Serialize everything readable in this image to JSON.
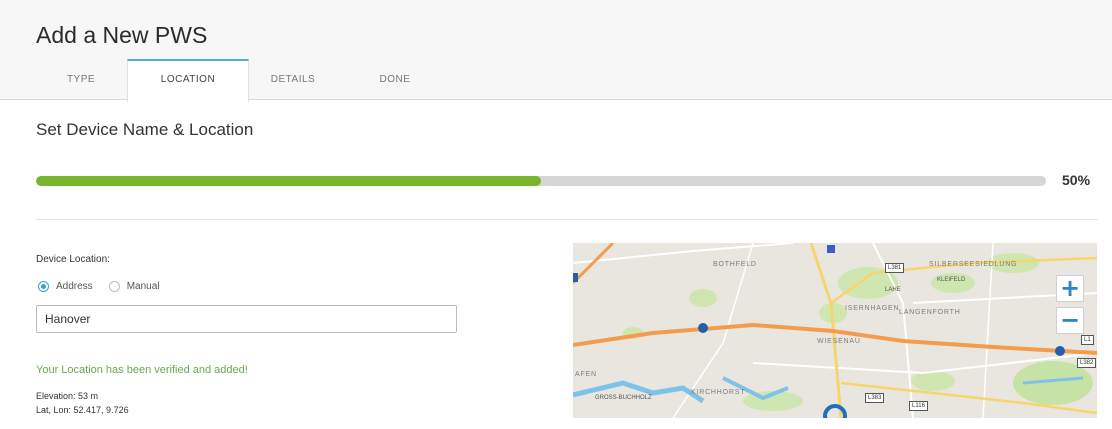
{
  "header": {
    "title": "Add a New PWS",
    "tabs": [
      {
        "label": "TYPE"
      },
      {
        "label": "LOCATION"
      },
      {
        "label": "DETAILS"
      },
      {
        "label": "DONE"
      }
    ],
    "active_tab": "LOCATION"
  },
  "main": {
    "section_title": "Set Device Name & Location",
    "progress": {
      "value": 0.5,
      "label": "50%"
    },
    "device_location_label": "Device Location:",
    "radio_options": [
      {
        "label": "Address",
        "checked": true
      },
      {
        "label": "Manual",
        "checked": false
      }
    ],
    "address_input": {
      "value": "Hanover",
      "placeholder": ""
    },
    "verified_message": "Your Location has been verified and added!",
    "elevation": "Elevation: 53 m",
    "lat_lon": "Lat, Lon: 52.417, 9.726"
  },
  "map": {
    "labels": [
      "BOTHFELD",
      "SILBERSEESIEDLUNG",
      "KLEIFELD",
      "LAHE",
      "LANGENFORTH",
      "ISERNHAGEN",
      "WIESENAU",
      "AFEN",
      "KIRCHHORST",
      "GROSS-BUCHHOLZ"
    ],
    "road_badges": [
      "L381",
      "L382",
      "L383",
      "L116",
      "L1"
    ],
    "zoom_in": "+",
    "zoom_out": "−"
  },
  "colors": {
    "accent": "#3aa1d6",
    "progress": "#79b52a",
    "verified": "#6aa84f",
    "highway": "#f39c4e",
    "water": "#7fc2e8",
    "park": "#c6e2a4"
  }
}
